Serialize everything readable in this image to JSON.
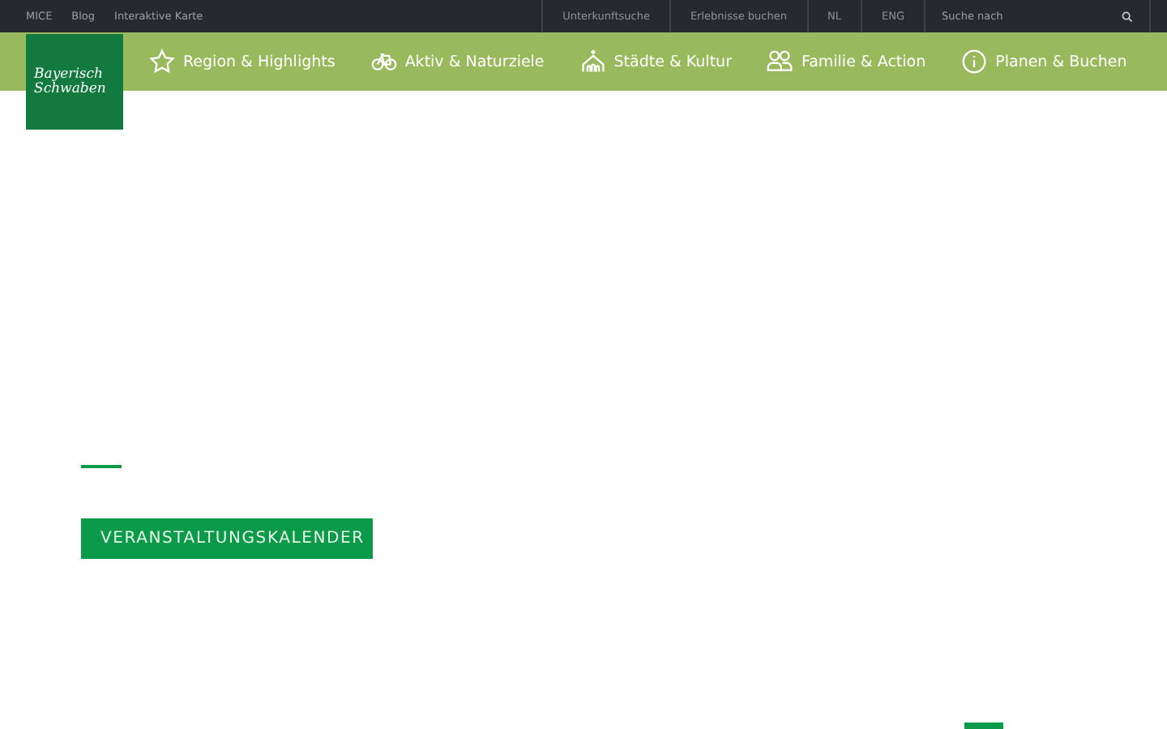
{
  "top_bar": {
    "links": [
      "MICE",
      "Blog",
      "Interaktive Karte"
    ],
    "service_links": [
      "Unterkunftsuche",
      "Erlebnisse buchen",
      "NL",
      "ENG"
    ],
    "search": {
      "placeholder": "Suche nach"
    }
  },
  "logo": {
    "lines": [
      "Bayerisch",
      "Schwaben"
    ]
  },
  "nav": [
    {
      "label": "Region & Highlights"
    },
    {
      "label": "Aktiv & Naturziele"
    },
    {
      "label": "Städte & Kultur"
    },
    {
      "label": "Familie & Action"
    },
    {
      "label": "Planen & Buchen"
    }
  ],
  "hero": {
    "button": "VERANSTALTUNGSKALENDER"
  }
}
